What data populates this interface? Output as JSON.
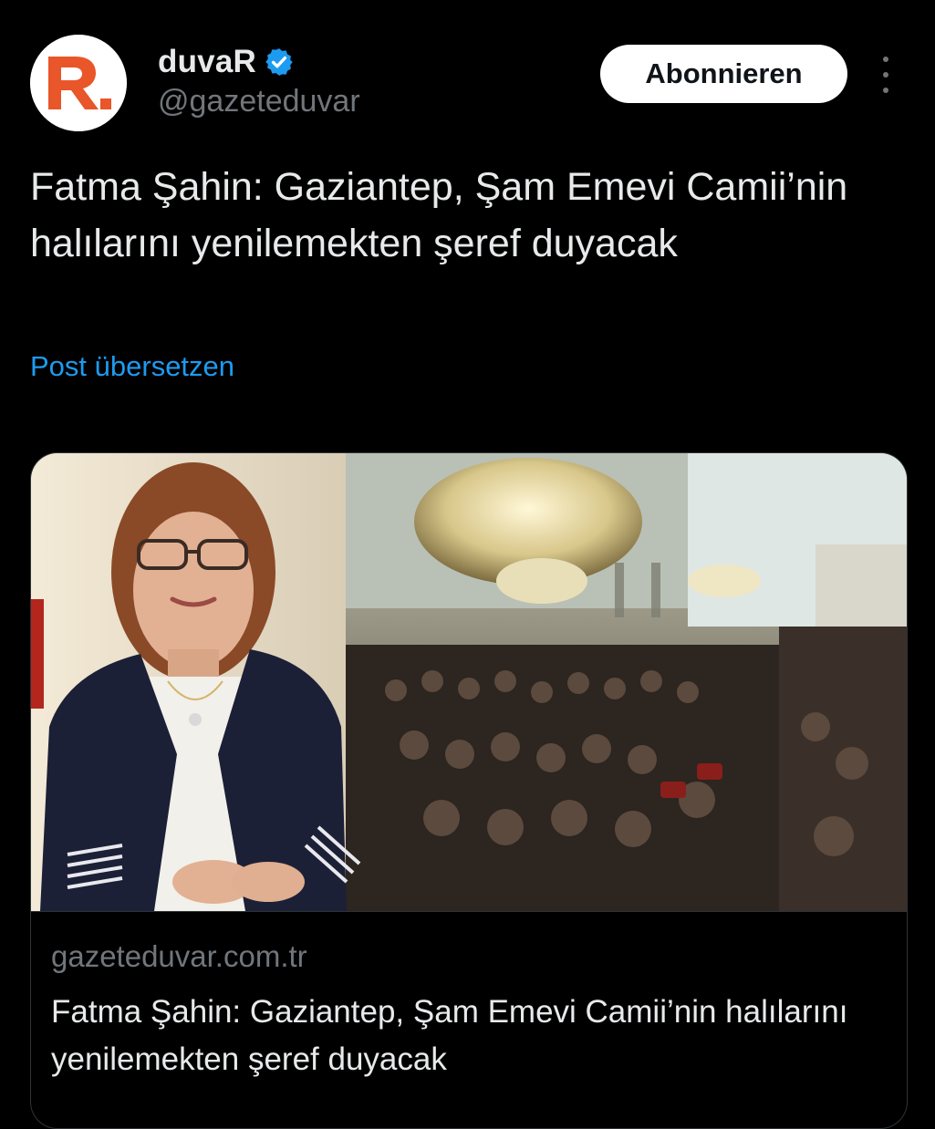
{
  "account": {
    "display_name": "duvaR",
    "handle": "@gazeteduvar",
    "avatar_letter": "R.",
    "brand_color": "#e8562a",
    "verified": true
  },
  "actions": {
    "subscribe_label": "Abonnieren",
    "more_icon": "more-vertical-icon"
  },
  "post": {
    "text": "Fatma Şahin: Gaziantep, Şam Emevi Camii’nin halılarını yenilemekten şeref duyacak",
    "translate_label": "Post übersetzen"
  },
  "link_card": {
    "domain": "gazeteduvar.com.tr",
    "title": "Fatma Şahin: Gaziantep, Şam Emevi Camii’nin halılarını yenilemekten şeref duyacak"
  },
  "colors": {
    "background": "#000000",
    "text": "#e7e9ea",
    "secondary_text": "#71767b",
    "link": "#1d9bf0",
    "verified_badge": "#1d9bf0",
    "border": "#2f3336"
  }
}
